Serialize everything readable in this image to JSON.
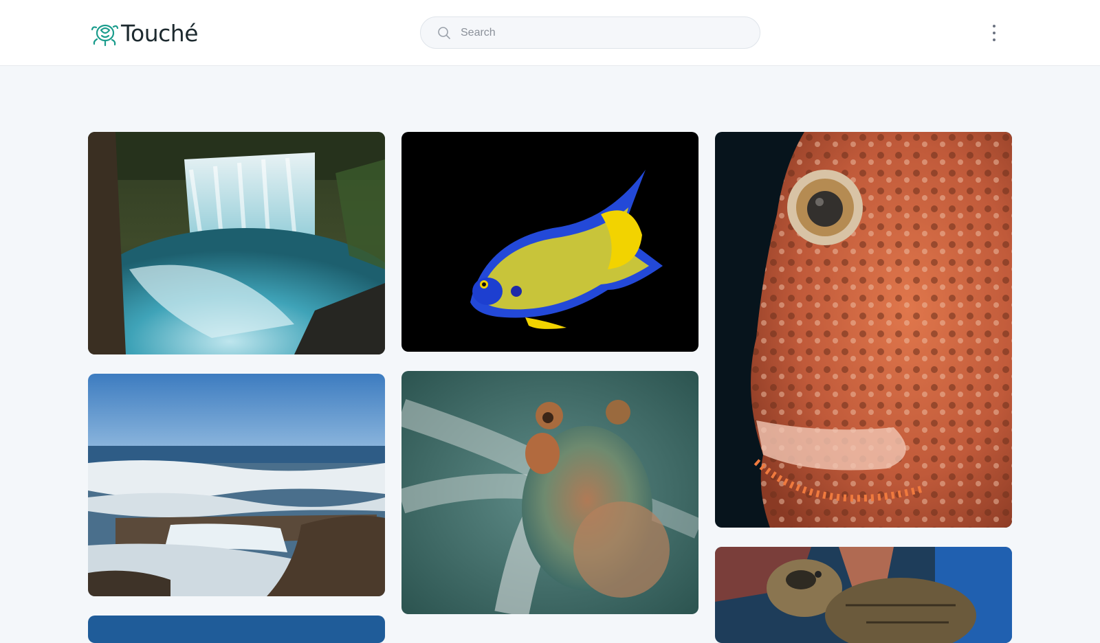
{
  "header": {
    "logo_text": "Touché",
    "search_placeholder": "Search",
    "menu_icon": "more-vertical-icon"
  },
  "brand_colors": {
    "accent": "#1a9c8c",
    "background": "#f4f7fa"
  },
  "gallery": {
    "photos": [
      {
        "subject": "waterfall"
      },
      {
        "subject": "queen-angelfish"
      },
      {
        "subject": "scorpionfish"
      },
      {
        "subject": "rocky-ocean-coast"
      },
      {
        "subject": "octopus"
      },
      {
        "subject": "sea-turtle"
      },
      {
        "subject": "blue-ocean"
      }
    ]
  }
}
